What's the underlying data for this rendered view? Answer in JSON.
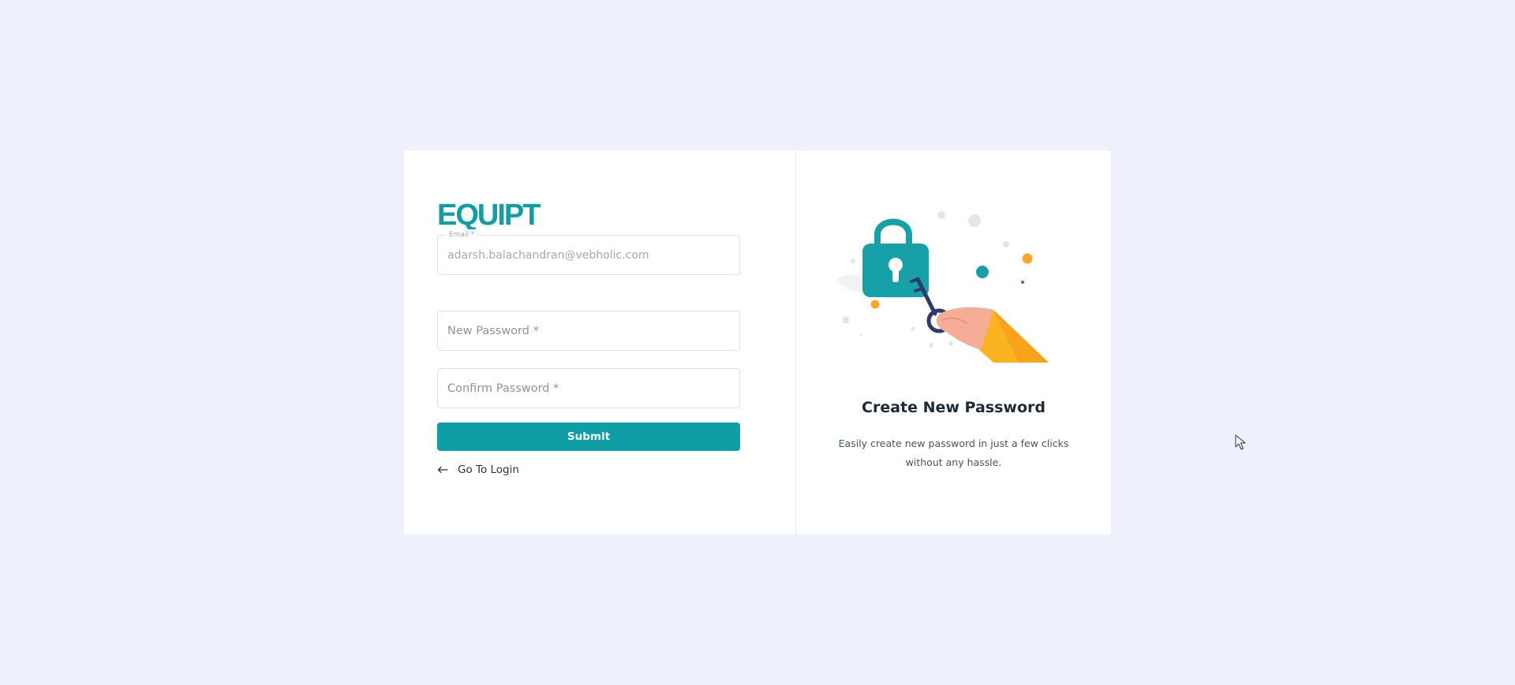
{
  "brand": {
    "logo_text": "EQUIPT",
    "accent_color": "#0f9ea6"
  },
  "form": {
    "email": {
      "label": "Email *",
      "value": "adarsh.balachandran@vebholic.com"
    },
    "new_password": {
      "placeholder": "New Password *"
    },
    "confirm_password": {
      "placeholder": "Confirm Password *"
    },
    "submit_label": "Submit",
    "go_to_login_label": "Go To Login"
  },
  "side_panel": {
    "illustration_icon": "padlock-key-hand-icon",
    "title": "Create New Password",
    "description": "Easily create new password in just a few clicks without any hassle."
  },
  "colors": {
    "page_background": "#eef1fb",
    "card_background": "#ffffff",
    "primary": "#0f9ea6",
    "lock": "#16a0a8",
    "key": "#2f3b6a",
    "sleeve": "#fcb322",
    "hand": "#f6ad98"
  }
}
